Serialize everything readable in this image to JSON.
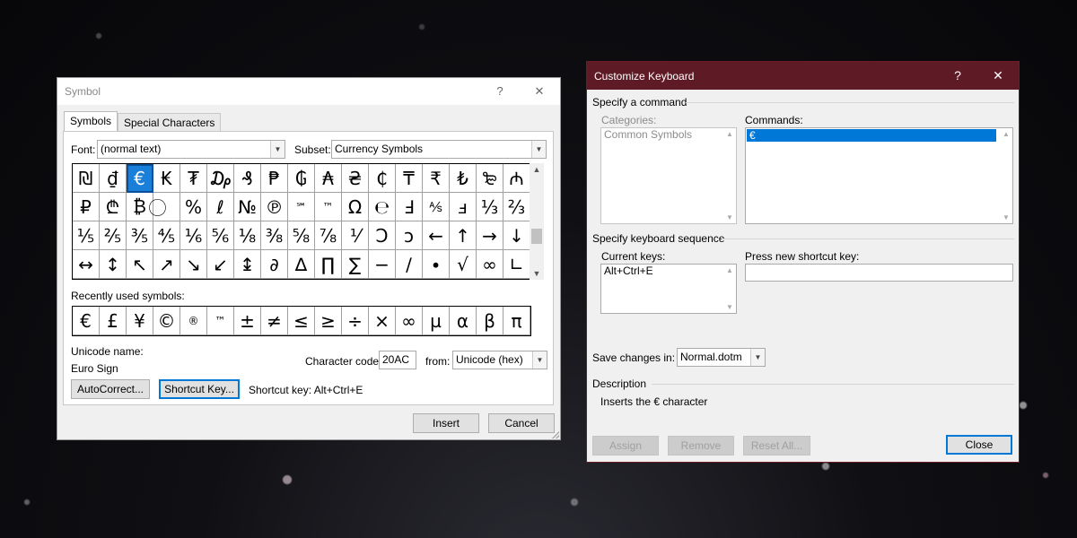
{
  "symbol_dialog": {
    "title": "Symbol",
    "help_glyph": "?",
    "close_glyph": "✕",
    "tabs": [
      {
        "label": "Symbols"
      },
      {
        "label": "Special Characters"
      }
    ],
    "font": {
      "label": "Font:",
      "value": "(normal text)"
    },
    "subset": {
      "label": "Subset:",
      "value": "Currency Symbols"
    },
    "symbols_grid": [
      [
        "₪",
        "₫",
        "€",
        "₭",
        "₮",
        "₯",
        "₰",
        "₱",
        "₲",
        "₳",
        "₴",
        "₵",
        "₸",
        "₹",
        "₺",
        "₻",
        "₼"
      ],
      [
        "₽",
        "₾",
        "₿",
        "⃝",
        "%",
        "ℓ",
        "№",
        "℗",
        "℠",
        "™",
        "Ω",
        "℮",
        "Ⅎ",
        "⅍",
        "ⅎ",
        "⅓",
        "⅔"
      ],
      [
        "⅕",
        "⅖",
        "⅗",
        "⅘",
        "⅙",
        "⅚",
        "⅛",
        "⅜",
        "⅝",
        "⅞",
        "⅟",
        "Ↄ",
        "ↄ",
        "←",
        "↑",
        "→",
        "↓"
      ],
      [
        "↔",
        "↕",
        "↖",
        "↗",
        "↘",
        "↙",
        "↨",
        "∂",
        "∆",
        "∏",
        "∑",
        "−",
        "∕",
        "∙",
        "√",
        "∞",
        "∟"
      ]
    ],
    "selected_symbol": "€",
    "recent_label": "Recently used symbols:",
    "recent_symbols": [
      "€",
      "£",
      "¥",
      "©",
      "®",
      "™",
      "±",
      "≠",
      "≤",
      "≥",
      "÷",
      "×",
      "∞",
      "µ",
      "α",
      "β",
      "π"
    ],
    "unicode_name_label": "Unicode name:",
    "unicode_name_value": "Euro Sign",
    "char_code_label": "Character code:",
    "char_code_value": "20AC",
    "from_label": "from:",
    "from_value": "Unicode (hex)",
    "autocorrect_label": "AutoCorrect...",
    "shortcut_key_btn_label": "Shortcut Key...",
    "shortcut_key_text": "Shortcut key: Alt+Ctrl+E",
    "insert_label": "Insert",
    "cancel_label": "Cancel"
  },
  "customize_dialog": {
    "title": "Customize Keyboard",
    "help_glyph": "?",
    "close_glyph": "✕",
    "specify_command_label": "Specify a command",
    "categories_label": "Categories:",
    "categories_items": [
      "Common Symbols"
    ],
    "commands_label": "Commands:",
    "commands_items": [
      "€"
    ],
    "specify_sequence_label": "Specify keyboard sequence",
    "current_keys_label": "Current keys:",
    "current_keys_items": [
      "Alt+Ctrl+E"
    ],
    "press_new_label": "Press new shortcut key:",
    "press_new_value": "",
    "save_changes_label": "Save changes in:",
    "save_changes_value": "Normal.dotm",
    "description_label": "Description",
    "description_text": "Inserts the € character",
    "assign_label": "Assign",
    "remove_label": "Remove",
    "reset_all_label": "Reset All...",
    "close_label": "Close"
  },
  "colors": {
    "customize_titlebar": "#5e1a25",
    "selection_blue": "#1a7fd8",
    "focus_border": "#0078d7"
  }
}
